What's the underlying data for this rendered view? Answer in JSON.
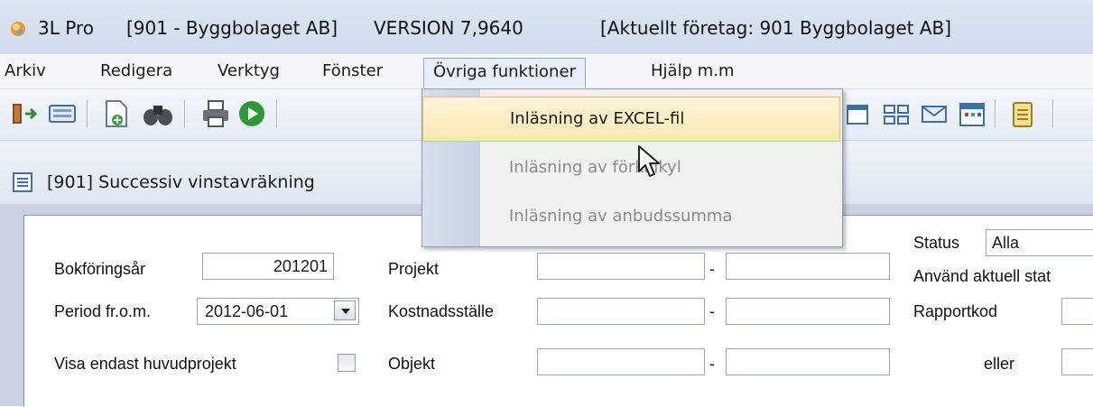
{
  "window": {
    "app": "3L Pro",
    "company_bracket": "[901 - Byggbolaget AB]",
    "version": "VERSION 7,9640",
    "current_company": "[Aktuellt företag: 901 Byggbolaget AB]"
  },
  "menu": {
    "items": [
      "Arkiv",
      "Redigera",
      "Verktyg",
      "Fönster",
      "Övriga funktioner",
      "Hjälp m.m"
    ],
    "active_index": 4
  },
  "dropdown": {
    "items": [
      {
        "label": "Inläsning av EXCEL-fil",
        "state": "highlighted"
      },
      {
        "label": "Inläsning av förkalkyl",
        "state": "disabled"
      },
      {
        "label": "Inläsning av anbudssumma",
        "state": "disabled"
      }
    ]
  },
  "child_window": {
    "title": "[901]  Successiv vinstavräkning"
  },
  "form": {
    "status_label": "Status",
    "status_value": "Alla",
    "bokforingsar_label": "Bokföringsår",
    "bokforingsar_value": "201201",
    "projekt_label": "Projekt",
    "anvand_label": "Använd aktuell stat",
    "period_label": "Period fr.o.m.",
    "period_value": "2012-06-01",
    "kostnadsstalle_label": "Kostnadsställe",
    "rapportkod_label": "Rapportkod",
    "visa_label": "Visa endast huvudprojekt",
    "objekt_label": "Objekt",
    "eller_label": "eller",
    "dash": "-"
  },
  "colors": {
    "titlebar": "#dbe6f3",
    "menu_highlight": "#fbe8b2",
    "mdi_background": "#c9d2de"
  },
  "icons": [
    "exit-icon",
    "keyboard-icon",
    "new-document-icon",
    "binoculars-icon",
    "printer-icon",
    "play-icon",
    "window-icon",
    "grid-icon",
    "mail-icon",
    "calendar-icon",
    "notepad-icon"
  ]
}
